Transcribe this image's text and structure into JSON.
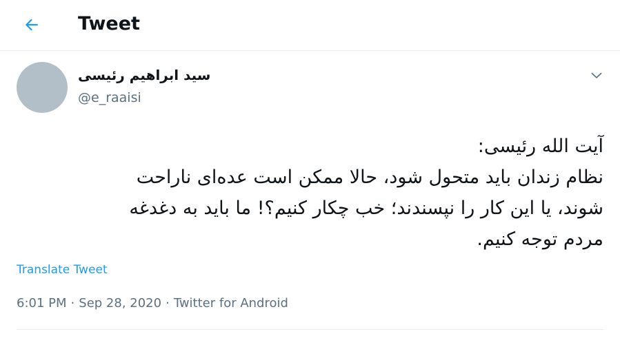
{
  "header": {
    "back_icon": "arrow-left-icon",
    "title": "Tweet",
    "accent_color": "#1d9bf0"
  },
  "tweet": {
    "author": {
      "display_name": "سید ابراهیم رئیسی",
      "handle": "@e_raaisi"
    },
    "menu_icon": "chevron-down-icon",
    "text_lines": [
      "آیت الله رئیسی:",
      "نظام زندان باید متحول شود، حالا ممکن است عده‌ای ناراحت",
      "شوند، یا این کار را نپسندند؛ خب چکار کنیم؟! ما باید به دغدغه",
      "مردم توجه کنیم."
    ],
    "translate_label": "Translate Tweet",
    "time": "6:01 PM",
    "date": "Sep 28, 2020",
    "separator": "·",
    "source": "Twitter for Android"
  }
}
